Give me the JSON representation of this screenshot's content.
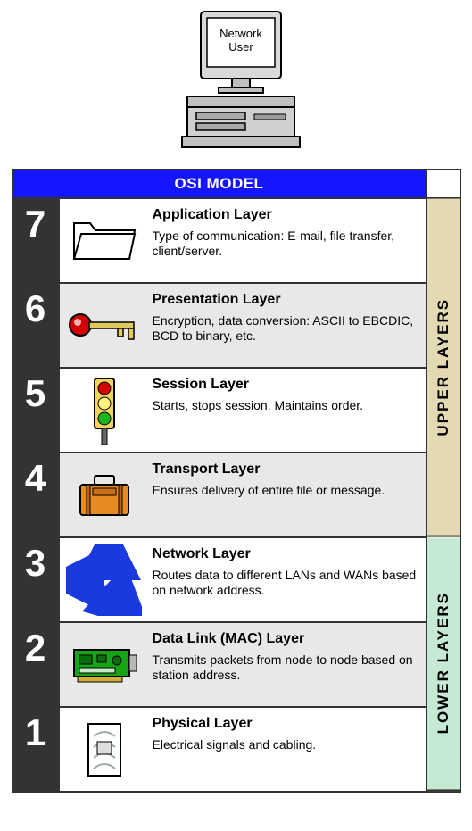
{
  "computer_label": "Network User",
  "title": "OSI MODEL",
  "side_upper": "UPPER LAYERS",
  "side_lower": "LOWER LAYERS",
  "layers": [
    {
      "num": "7",
      "name": "Application Layer",
      "desc": "Type of communication: E-mail, file transfer, client/server.",
      "alt": false
    },
    {
      "num": "6",
      "name": "Presentation Layer",
      "desc": "Encryption, data conversion: ASCII to EBCDIC, BCD to binary, etc.",
      "alt": true
    },
    {
      "num": "5",
      "name": "Session Layer",
      "desc": "Starts, stops session. Maintains order.",
      "alt": false
    },
    {
      "num": "4",
      "name": "Transport Layer",
      "desc": "Ensures delivery of entire file or message.",
      "alt": true
    },
    {
      "num": "3",
      "name": "Network Layer",
      "desc": "Routes data to different LANs and WANs based on network address.",
      "alt": false
    },
    {
      "num": "2",
      "name": "Data Link (MAC) Layer",
      "desc": "Transmits packets from node to node based on station address.",
      "alt": true
    },
    {
      "num": "1",
      "name": "Physical Layer",
      "desc": "Electrical signals and cabling.",
      "alt": false
    }
  ]
}
